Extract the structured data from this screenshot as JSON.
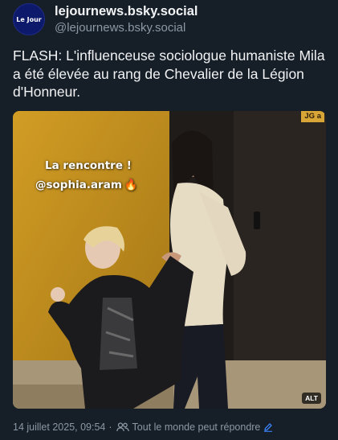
{
  "author": {
    "avatar_text": "Le Jour",
    "display_name": "lejournews.bsky.social",
    "handle": "@lejournews.bsky.social"
  },
  "post": {
    "text": "FLASH: L'influenceuse sociologue humaniste Mila a été élevée au rang de Chevalier de la Légion d'Honneur."
  },
  "media": {
    "story_line1": "La rencontre !",
    "story_line2": "@sophia.aram",
    "flame": "🔥",
    "corner_tag": "JG a",
    "alt_badge": "ALT"
  },
  "footer": {
    "timestamp": "14 juillet 2025, 09:54",
    "separator": "·",
    "reply_setting": "Tout le monde peut répondre"
  },
  "colors": {
    "background": "#161e27",
    "accent": "#3b82f6",
    "muted": "#8b98a5"
  }
}
